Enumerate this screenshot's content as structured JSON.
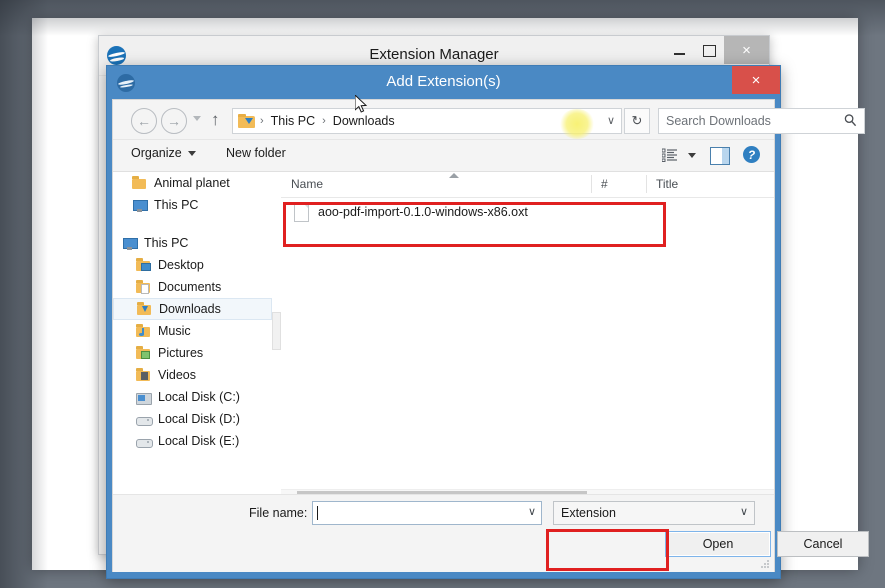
{
  "ext_manager": {
    "title": "Extension Manager",
    "icon": "openoffice-seagull-icon",
    "minimize_label": "",
    "maximize_label": "",
    "close_label": "×"
  },
  "dialog": {
    "title": "Add Extension(s)",
    "icon": "openoffice-seagull-icon",
    "close_label": "×"
  },
  "navbar": {
    "back_label": "←",
    "forward_label": "→",
    "up_label": "↑",
    "recent_label": "",
    "breadcrumbs": [
      "This PC",
      "Downloads"
    ],
    "separator": "›",
    "dropdown_label": "∨",
    "refresh_label": "↻",
    "search_placeholder": "Search Downloads"
  },
  "cmdbar": {
    "organize_label": "Organize",
    "new_folder_label": "New folder",
    "view_icon": "view-list-icon",
    "preview_icon": "preview-pane-icon",
    "help_icon": "help-icon",
    "help_glyph": "?"
  },
  "nav_pane": {
    "groups": [
      {
        "items": [
          {
            "label": "Animal planet",
            "icon": "folder-icon",
            "indent": 18,
            "selected": false
          },
          {
            "label": "This PC",
            "icon": "computer-icon",
            "indent": 18,
            "selected": false
          }
        ]
      },
      {
        "items": [
          {
            "label": "This PC",
            "icon": "computer-icon",
            "indent": 8,
            "selected": false
          },
          {
            "label": "Desktop",
            "icon": "folder-desktop-icon",
            "indent": 22,
            "selected": false
          },
          {
            "label": "Documents",
            "icon": "folder-documents-icon",
            "indent": 22,
            "selected": false
          },
          {
            "label": "Downloads",
            "icon": "folder-downloads-icon",
            "indent": 22,
            "selected": true
          },
          {
            "label": "Music",
            "icon": "folder-music-icon",
            "indent": 22,
            "selected": false
          },
          {
            "label": "Pictures",
            "icon": "folder-pictures-icon",
            "indent": 22,
            "selected": false
          },
          {
            "label": "Videos",
            "icon": "folder-videos-icon",
            "indent": 22,
            "selected": false
          },
          {
            "label": "Local Disk (C:)",
            "icon": "disk-system-icon",
            "indent": 22,
            "selected": false
          },
          {
            "label": "Local Disk (D:)",
            "icon": "drive-icon",
            "indent": 22,
            "selected": false
          },
          {
            "label": "Local Disk (E:)",
            "icon": "drive-icon",
            "indent": 22,
            "selected": false
          }
        ]
      }
    ],
    "scroll_up": "⌃",
    "scroll_down": "⌄"
  },
  "file_list": {
    "columns": [
      "Name",
      "#",
      "Title"
    ],
    "sort_column": "Name",
    "sort_direction": "ascending",
    "rows": [
      {
        "name": "aoo-pdf-import-0.1.0-windows-x86.oxt",
        "num": "",
        "title": "",
        "icon": "file-icon",
        "highlighted": true
      }
    ],
    "hscroll_left": "‹",
    "hscroll_right": "›"
  },
  "footer": {
    "filename_label": "File name:",
    "filename_value": "",
    "filename_chevron": "∨",
    "filter_value": "Extension",
    "filter_chevron": "∨",
    "open_label": "Open",
    "cancel_label": "Cancel"
  },
  "annotations": {
    "highlight_color": "#e02020",
    "cursor_highlight_color": "#f7f06e",
    "boxes": [
      "file-row-highlight",
      "open-button-highlight"
    ]
  },
  "colors": {
    "dialog_titlebar": "#4a89c4",
    "dialog_close": "#d8504a",
    "desktop": "#6e7680",
    "accent_blue": "#1b72b8",
    "focus_border": "#7eb4ea"
  }
}
